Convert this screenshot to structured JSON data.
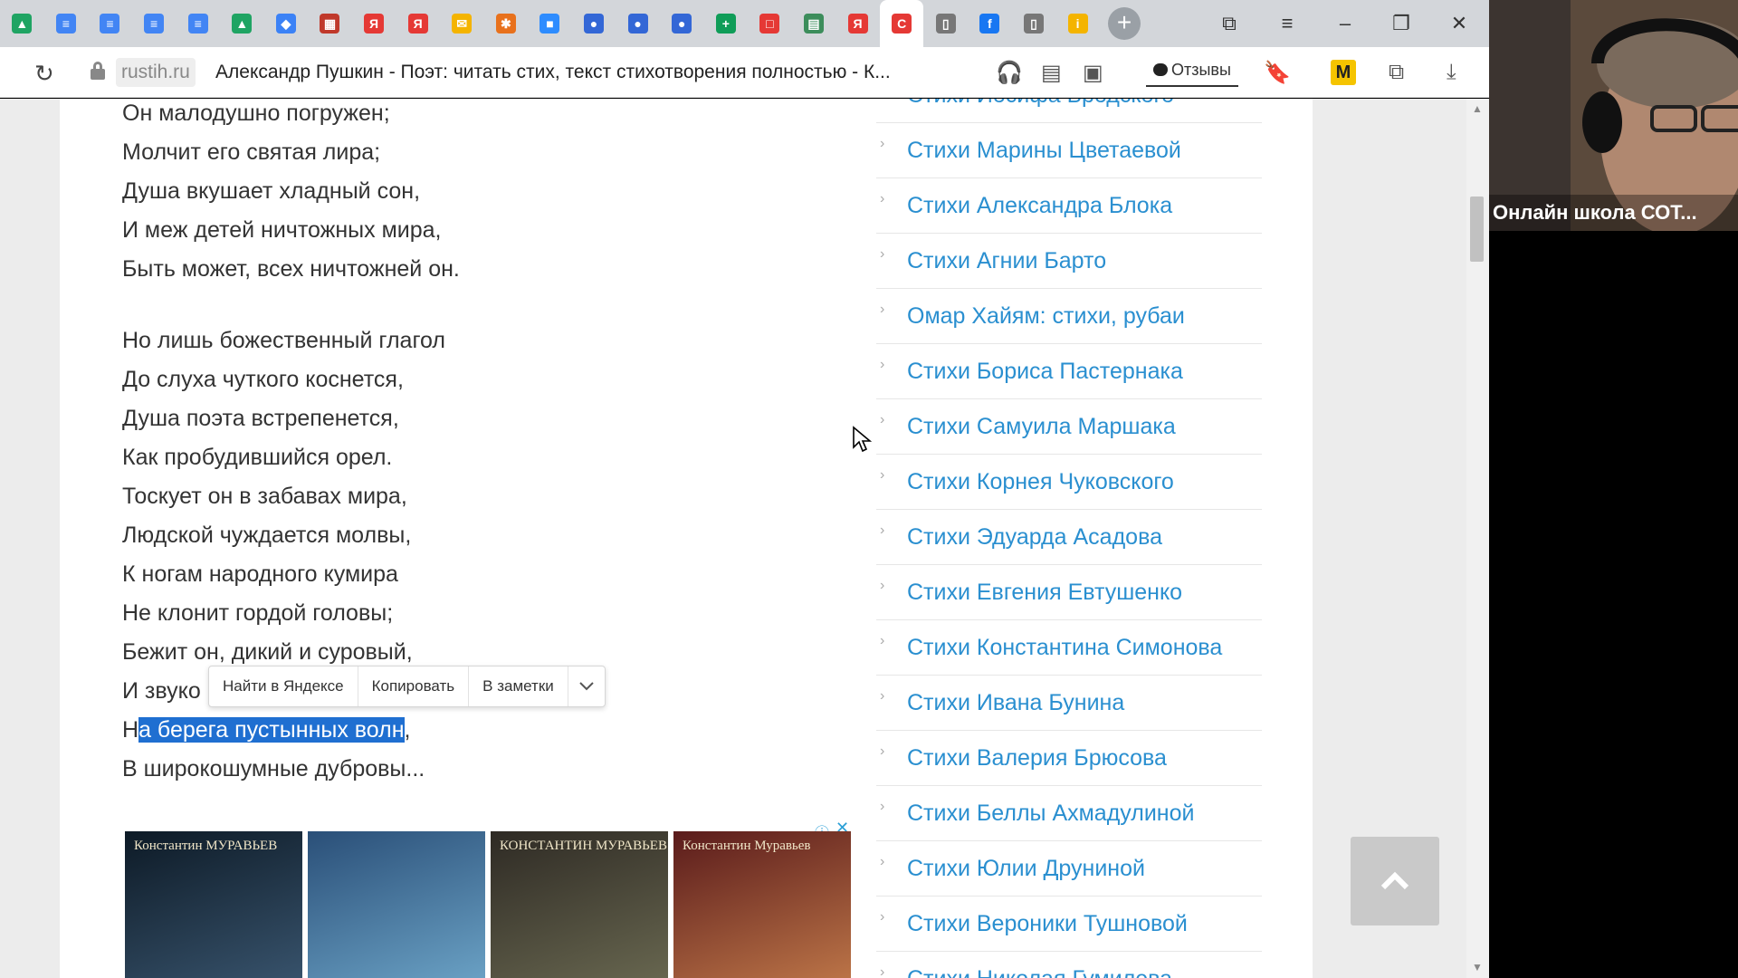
{
  "browser": {
    "domain": "rustih.ru",
    "page_title": "Александр Пушкин - Поэт: читать стих, текст стихотворения полностью - К...",
    "reviews_label": "Отзывы",
    "tab_icons": [
      {
        "name": "google-drive-icon",
        "color": "#1fa463",
        "glyph": "▲"
      },
      {
        "name": "docs-icon",
        "color": "#4285f4",
        "glyph": "≡"
      },
      {
        "name": "docs-icon",
        "color": "#4285f4",
        "glyph": "≡"
      },
      {
        "name": "docs-icon",
        "color": "#4285f4",
        "glyph": "≡"
      },
      {
        "name": "docs-icon",
        "color": "#4285f4",
        "glyph": "≡"
      },
      {
        "name": "google-drive-icon",
        "color": "#1fa463",
        "glyph": "▲"
      },
      {
        "name": "cube-icon",
        "color": "#3b82f6",
        "glyph": "◆"
      },
      {
        "name": "board-icon",
        "color": "#c0392b",
        "glyph": "▦"
      },
      {
        "name": "yandex-icon",
        "color": "#e53935",
        "glyph": "Я"
      },
      {
        "name": "yandex-icon",
        "color": "#e53935",
        "glyph": "Я"
      },
      {
        "name": "mail-icon",
        "color": "#f4b400",
        "glyph": "✉"
      },
      {
        "name": "app-icon",
        "color": "#e8711c",
        "glyph": "✱"
      },
      {
        "name": "zoom-icon",
        "color": "#2d8cff",
        "glyph": "■"
      },
      {
        "name": "flag-ru-icon",
        "color": "#3367d6",
        "glyph": "●"
      },
      {
        "name": "flag-ru-icon",
        "color": "#3367d6",
        "glyph": "●"
      },
      {
        "name": "flag-ru-icon",
        "color": "#3367d6",
        "glyph": "●"
      },
      {
        "name": "sheets-icon",
        "color": "#0f9d58",
        "glyph": "+"
      },
      {
        "name": "red-square-icon",
        "color": "#e53935",
        "glyph": "□"
      },
      {
        "name": "sheet-icon",
        "color": "#3c8d5b",
        "glyph": "▤"
      },
      {
        "name": "yandex-icon",
        "color": "#e53935",
        "glyph": "Я"
      },
      {
        "name": "c-logo-icon",
        "color": "#e53935",
        "glyph": "C",
        "active": true
      },
      {
        "name": "document-icon",
        "color": "#777777",
        "glyph": "▯"
      },
      {
        "name": "facebook-icon",
        "color": "#1877f2",
        "glyph": "f"
      },
      {
        "name": "document-icon",
        "color": "#777777",
        "glyph": "▯"
      },
      {
        "name": "info-icon",
        "color": "#f4b400",
        "glyph": "i"
      }
    ]
  },
  "poem": {
    "lines": [
      "Он малодушно погружен;",
      "Молчит его святая лира;",
      "Душа вкушает хладный сон,",
      "И меж детей ничтожных мира,",
      "Быть может, всех ничтожней он.",
      "Но лишь божественный глагол",
      "До слуха чуткого коснется,",
      "Душа поэта встрепенется,",
      "Как пробудившийся орел.",
      "Тоскует он в забавах мира,",
      "Людской чуждается молвы,",
      "К ногам народного кумира",
      "Не клонит гордой головы;",
      "Бежит он, дикий и суровый,",
      "И звуко",
      "В широкошумные дубровы..."
    ],
    "selected_line_prefix": "Н",
    "selected_text": "а берега пустынных волн",
    "selected_line_suffix": ","
  },
  "context_menu": {
    "items": [
      "Найти в Яндексе",
      "Копировать",
      "В заметки"
    ]
  },
  "ads": {
    "cards": [
      {
        "caption": "Константин МУРАВЬЕВ",
        "colors": [
          "#0d1a26",
          "#3a5670"
        ]
      },
      {
        "caption": "",
        "colors": [
          "#2a4f78",
          "#6ea6c9"
        ]
      },
      {
        "caption": "КОНСТАНТИН МУРАВЬЕВ",
        "colors": [
          "#2e2a24",
          "#6b6a52"
        ]
      },
      {
        "caption": "Константин Муравьев",
        "colors": [
          "#5a1b1b",
          "#c27a4a"
        ]
      }
    ]
  },
  "sidebar": {
    "top_partial": "Стихи Иосифа Бродского",
    "items": [
      "Стихи Марины Цветаевой",
      "Стихи Александра Блока",
      "Стихи Агнии Барто",
      "Омар Хайям: стихи, рубаи",
      "Стихи Бориса Пастернака",
      "Стихи Самуила Маршака",
      "Стихи Корнея Чуковского",
      "Стихи Эдуарда Асадова",
      "Стихи Евгения Евтушенко",
      "Стихи Константина Симонова",
      "Стихи Ивана Бунина",
      "Стихи Валерия Брюсова",
      "Стихи Беллы Ахмадулиной",
      "Стихи Юлии Друниной",
      "Стихи Вероники Тушновой"
    ],
    "bottom_partial": "Стихи Николая Гумилева"
  },
  "webcam": {
    "label": "Онлайн школа СОТ..."
  }
}
